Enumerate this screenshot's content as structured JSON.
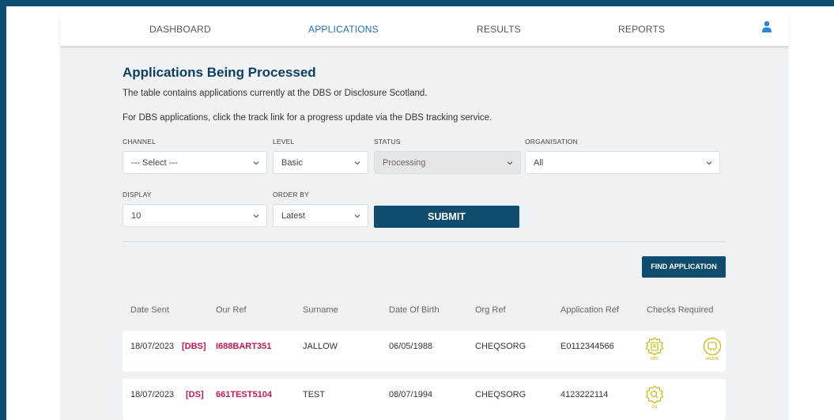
{
  "nav": {
    "dashboard": "DASHBOARD",
    "applications": "APPLICATIONS",
    "results": "RESULTS",
    "reports": "REPORTS"
  },
  "page": {
    "title": "Applications Being Processed",
    "desc1": "The table contains applications currently at the DBS or Disclosure Scotland.",
    "desc2": "For DBS applications, click the track link for a progress update via the DBS tracking service."
  },
  "filters": {
    "channel": {
      "label": "CHANNEL",
      "value": "--- Select ---"
    },
    "level": {
      "label": "LEVEL",
      "value": "Basic"
    },
    "status": {
      "label": "STATUS",
      "value": "Processing"
    },
    "organisation": {
      "label": "ORGANISATION",
      "value": "All"
    },
    "display": {
      "label": "DISPLAY",
      "value": "10"
    },
    "order_by": {
      "label": "ORDER BY",
      "value": "Latest"
    },
    "submit": "SUBMIT"
  },
  "find_button": "FIND APPLICATION",
  "table": {
    "headers": [
      "Date Sent",
      "Our Ref",
      "Surname",
      "Date Of Birth",
      "Org Ref",
      "Application Ref",
      "Checks Required"
    ],
    "rows": [
      {
        "date_sent": "18/07/2023",
        "tag": "[DBS]",
        "our_ref": "I688BART351",
        "surname": "JALLOW",
        "dob": "06/05/1988",
        "org_ref": "CHEQSORG",
        "app_ref": "E0112344566",
        "check1": "DBS",
        "check2": "MEDIA"
      },
      {
        "date_sent": "18/07/2023",
        "tag": "[DS]",
        "our_ref": "661TEST5104",
        "surname": "TEST",
        "dob": "08/07/1994",
        "org_ref": "CHEQSORG",
        "app_ref": "4123222114",
        "check1": "DS"
      }
    ]
  },
  "colors": {
    "brand": "#0f4c6e",
    "link": "#1f6fb2",
    "ref": "#c2185b",
    "check_icon": "#c9b400"
  }
}
